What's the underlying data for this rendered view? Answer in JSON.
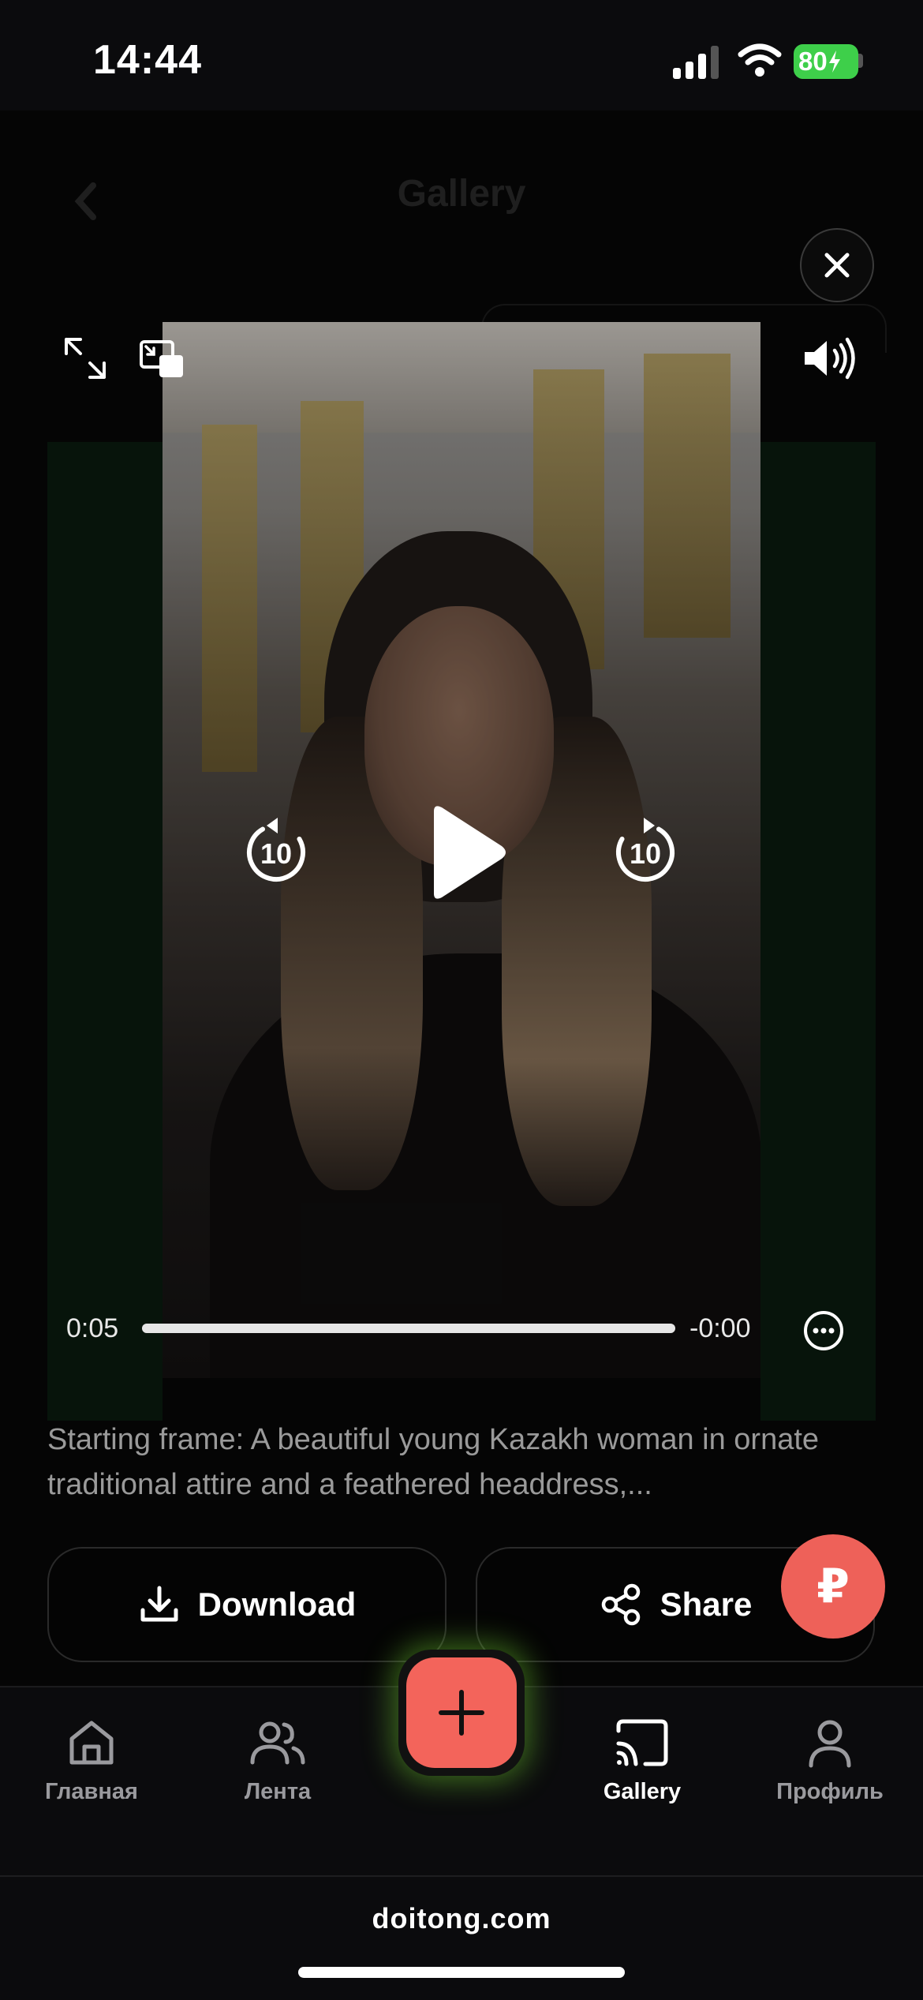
{
  "status": {
    "time": "14:44",
    "battery": "80",
    "battery_color": "#3ecf4a"
  },
  "background": {
    "title": "Gallery"
  },
  "player": {
    "elapsed": "0:05",
    "remaining": "-0:00",
    "progress": 1.0,
    "skip_back_label": "10",
    "skip_forward_label": "10"
  },
  "prompt": {
    "text": "Starting frame: A beautiful young Kazakh woman in ornate traditional attire and a feathered headdress,..."
  },
  "actions": {
    "download_label": "Download",
    "share_label": "Share",
    "currency_symbol": "₽"
  },
  "nav": {
    "items": [
      {
        "label": "Главная",
        "icon": "home-icon"
      },
      {
        "label": "Лента",
        "icon": "users-icon"
      },
      {
        "label": "Gallery",
        "icon": "cast-icon"
      },
      {
        "label": "Профиль",
        "icon": "user-icon"
      }
    ],
    "active": "Gallery",
    "add_button_color": "#f3645b"
  },
  "browser": {
    "url": "doitong.com"
  }
}
